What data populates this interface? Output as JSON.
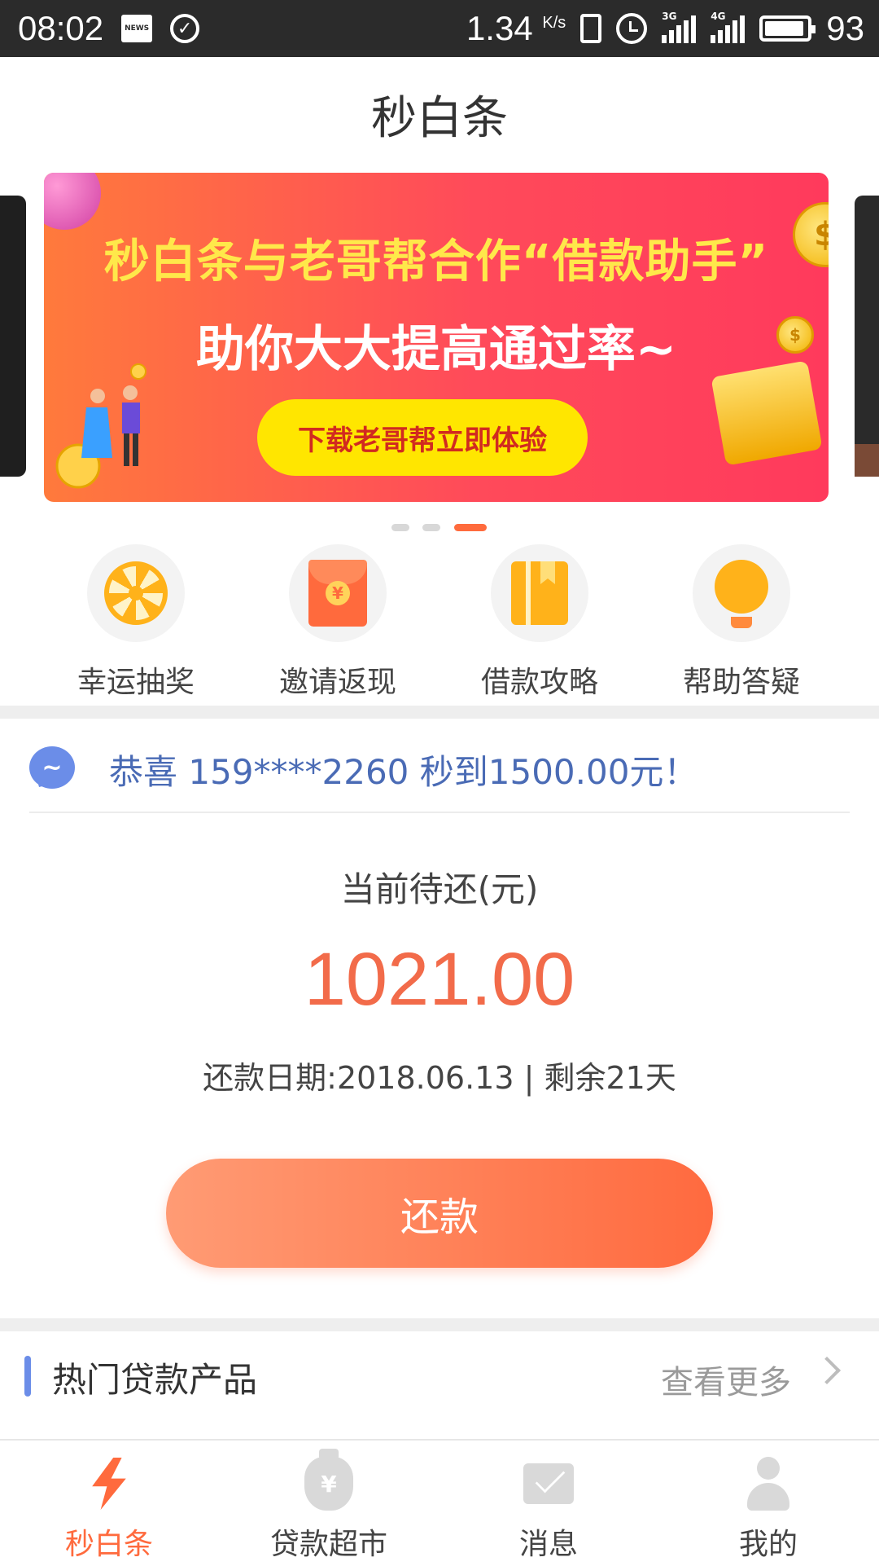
{
  "status_bar": {
    "time": "08:02",
    "news_icon": "NEWS",
    "speed": "1.34",
    "speed_unit": "K/s",
    "net1": "3G",
    "net2": "4G",
    "battery_level": "93"
  },
  "header": {
    "title": "秒白条"
  },
  "banner": {
    "headline": "秒白条与老哥帮合作“借款助手”",
    "subline": "助你大大提高通过率~",
    "cta": "下载老哥帮立即体验",
    "active_slide": 3,
    "total_slides": 3
  },
  "quick_menu": [
    {
      "label": "幸运抽奖",
      "icon": "prize-wheel-icon"
    },
    {
      "label": "邀请返现",
      "icon": "red-envelope-icon"
    },
    {
      "label": "借款攻略",
      "icon": "guide-book-icon"
    },
    {
      "label": "帮助答疑",
      "icon": "lightbulb-icon"
    }
  ],
  "notice": {
    "text": "恭喜 159****2260 秒到1500.00元！"
  },
  "repayment": {
    "label": "当前待还(元)",
    "amount": "1021.00",
    "due_text": "还款日期:2018.06.13 | 剩余21天",
    "button": "还款"
  },
  "section": {
    "title": "热门贷款产品",
    "more": "查看更多"
  },
  "tabs": [
    {
      "label": "秒白条",
      "icon": "lightning-icon",
      "active": true
    },
    {
      "label": "贷款超市",
      "icon": "money-bag-icon",
      "active": false
    },
    {
      "label": "消息",
      "icon": "mail-icon",
      "active": false
    },
    {
      "label": "我的",
      "icon": "person-icon",
      "active": false
    }
  ],
  "colors": {
    "accent": "#ff6a3d",
    "link": "#4a6bb5",
    "amount": "#f26b4a"
  }
}
